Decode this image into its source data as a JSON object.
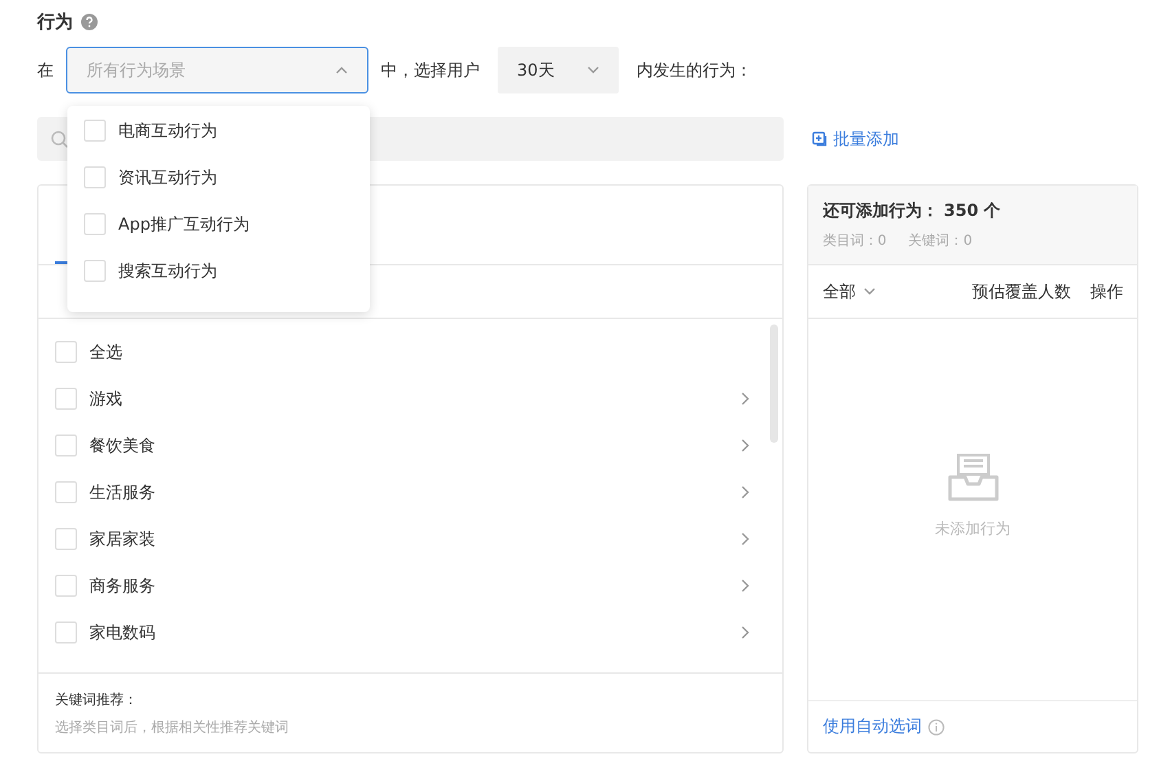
{
  "section_title": "行为",
  "filter": {
    "prefix": "在",
    "scene_placeholder": "所有行为场景",
    "middle": "中，选择用户",
    "period": "30天",
    "suffix": "内发生的行为："
  },
  "scene_options": [
    {
      "label": "电商互动行为",
      "checked": false
    },
    {
      "label": "资讯互动行为",
      "checked": false
    },
    {
      "label": "App推广互动行为",
      "checked": false
    },
    {
      "label": "搜索互动行为",
      "checked": false
    }
  ],
  "batch_add": "批量添加",
  "left_panel": {
    "tab": {
      "selected": true
    },
    "items": [
      {
        "label": "全选",
        "checked": false,
        "expandable": false
      },
      {
        "label": "游戏",
        "checked": false,
        "expandable": true
      },
      {
        "label": "餐饮美食",
        "checked": false,
        "expandable": true
      },
      {
        "label": "生活服务",
        "checked": false,
        "expandable": true
      },
      {
        "label": "家居家装",
        "checked": false,
        "expandable": true
      },
      {
        "label": "商务服务",
        "checked": false,
        "expandable": true
      },
      {
        "label": "家电数码",
        "checked": false,
        "expandable": true
      }
    ],
    "footer_title": "关键词推荐：",
    "footer_hint": "选择类目词后，根据相关性推荐关键词"
  },
  "right_panel": {
    "remaining": "还可添加行为： 350 个",
    "category_count": "类目词：0",
    "keyword_count": "关键词：0",
    "filter": "全部",
    "columns": [
      "预估覆盖人数",
      "操作"
    ],
    "empty_text": "未添加行为",
    "footer_link": "使用自动选词"
  }
}
